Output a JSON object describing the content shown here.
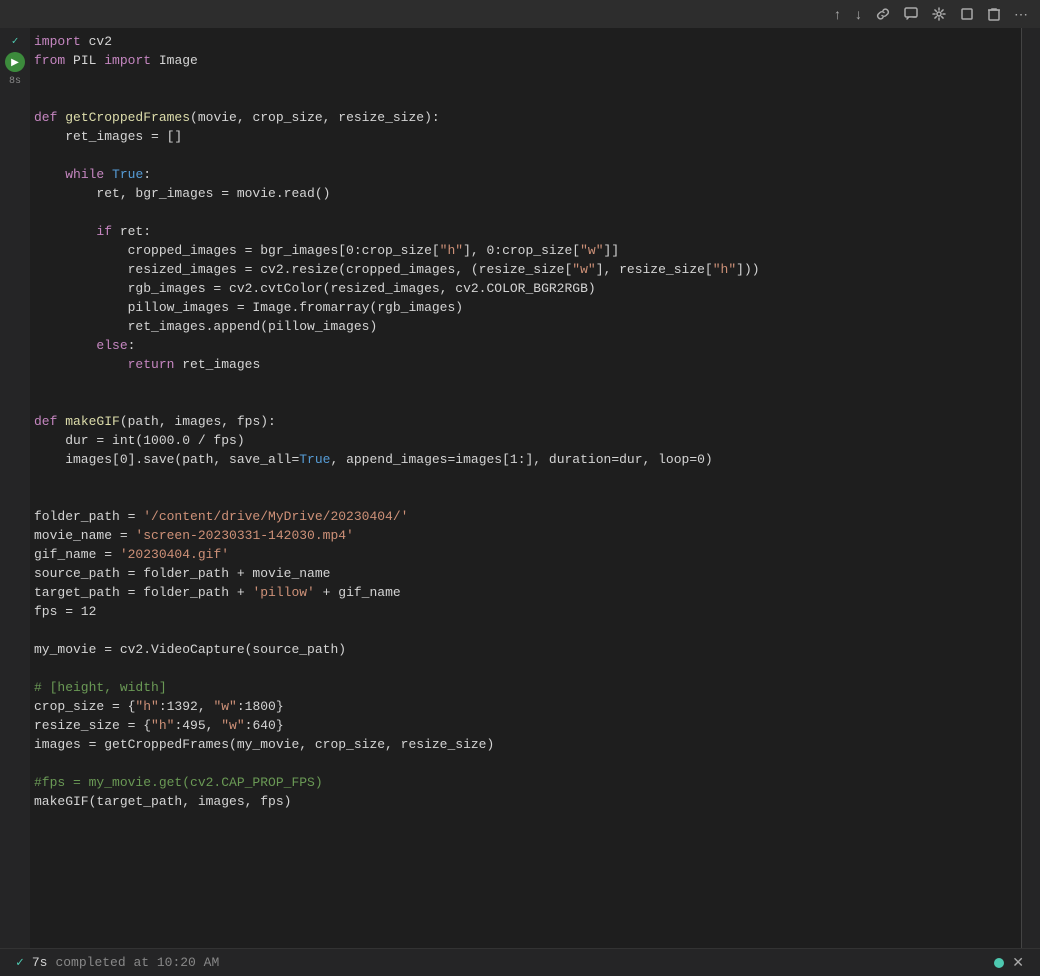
{
  "toolbar": {
    "buttons": [
      "↑",
      "↓",
      "🔗",
      "💬",
      "⚙",
      "⬜",
      "🗑",
      "⋯"
    ]
  },
  "code": {
    "lines": [
      {
        "tokens": [
          {
            "t": "kw",
            "v": "import"
          },
          {
            "t": "plain",
            "v": " cv2"
          }
        ]
      },
      {
        "tokens": [
          {
            "t": "kw",
            "v": "from"
          },
          {
            "t": "plain",
            "v": " PIL "
          },
          {
            "t": "kw",
            "v": "import"
          },
          {
            "t": "plain",
            "v": " Image"
          }
        ]
      },
      {
        "tokens": [
          {
            "t": "plain",
            "v": ""
          }
        ]
      },
      {
        "tokens": [
          {
            "t": "plain",
            "v": ""
          }
        ]
      },
      {
        "tokens": [
          {
            "t": "kw",
            "v": "def"
          },
          {
            "t": "plain",
            "v": " "
          },
          {
            "t": "fn",
            "v": "getCroppedFrames"
          },
          {
            "t": "plain",
            "v": "(movie, crop_size, resize_size):"
          }
        ]
      },
      {
        "tokens": [
          {
            "t": "plain",
            "v": "    ret_images = []"
          }
        ]
      },
      {
        "tokens": [
          {
            "t": "plain",
            "v": ""
          }
        ]
      },
      {
        "tokens": [
          {
            "t": "plain",
            "v": "    "
          },
          {
            "t": "kw",
            "v": "while"
          },
          {
            "t": "plain",
            "v": " "
          },
          {
            "t": "kw-blue",
            "v": "True"
          },
          {
            "t": "plain",
            "v": ":"
          }
        ]
      },
      {
        "tokens": [
          {
            "t": "plain",
            "v": "        ret, bgr_images = movie.read()"
          }
        ]
      },
      {
        "tokens": [
          {
            "t": "plain",
            "v": ""
          }
        ]
      },
      {
        "tokens": [
          {
            "t": "plain",
            "v": "        "
          },
          {
            "t": "kw",
            "v": "if"
          },
          {
            "t": "plain",
            "v": " ret:"
          }
        ]
      },
      {
        "tokens": [
          {
            "t": "plain",
            "v": "            cropped_images = bgr_images[0:crop_size["
          },
          {
            "t": "str",
            "v": "\"h\""
          },
          {
            "t": "plain",
            "v": "], 0:crop_size["
          },
          {
            "t": "str",
            "v": "\"w\""
          },
          {
            "t": "plain",
            "v": "]]"
          }
        ]
      },
      {
        "tokens": [
          {
            "t": "plain",
            "v": "            resized_images = cv2.resize(cropped_images, (resize_size["
          },
          {
            "t": "str",
            "v": "\"w\""
          },
          {
            "t": "plain",
            "v": "], resize_size["
          },
          {
            "t": "str",
            "v": "\"h\""
          },
          {
            "t": "plain",
            "v": "]))"
          }
        ]
      },
      {
        "tokens": [
          {
            "t": "plain",
            "v": "            rgb_images = cv2.cvtColor(resized_images, cv2.COLOR_BGR2RGB)"
          }
        ]
      },
      {
        "tokens": [
          {
            "t": "plain",
            "v": "            pillow_images = Image.fromarray(rgb_images)"
          }
        ]
      },
      {
        "tokens": [
          {
            "t": "plain",
            "v": "            ret_images.append(pillow_images)"
          }
        ]
      },
      {
        "tokens": [
          {
            "t": "plain",
            "v": "        "
          },
          {
            "t": "kw",
            "v": "else"
          },
          {
            "t": "plain",
            "v": ":"
          }
        ]
      },
      {
        "tokens": [
          {
            "t": "plain",
            "v": "            "
          },
          {
            "t": "kw",
            "v": "return"
          },
          {
            "t": "plain",
            "v": " ret_images"
          }
        ]
      },
      {
        "tokens": [
          {
            "t": "plain",
            "v": ""
          }
        ]
      },
      {
        "tokens": [
          {
            "t": "plain",
            "v": ""
          }
        ]
      },
      {
        "tokens": [
          {
            "t": "kw",
            "v": "def"
          },
          {
            "t": "plain",
            "v": " "
          },
          {
            "t": "fn",
            "v": "makeGIF"
          },
          {
            "t": "plain",
            "v": "(path, images, fps):"
          }
        ]
      },
      {
        "tokens": [
          {
            "t": "plain",
            "v": "    dur = int(1000.0 / fps)"
          }
        ]
      },
      {
        "tokens": [
          {
            "t": "plain",
            "v": "    images[0].save(path, save_all="
          },
          {
            "t": "kw-blue",
            "v": "True"
          },
          {
            "t": "plain",
            "v": ", append_images=images[1:], duration=dur, loop=0)"
          }
        ]
      },
      {
        "tokens": [
          {
            "t": "plain",
            "v": ""
          }
        ]
      },
      {
        "tokens": [
          {
            "t": "plain",
            "v": ""
          }
        ]
      },
      {
        "tokens": [
          {
            "t": "plain",
            "v": "folder_path = "
          },
          {
            "t": "str",
            "v": "'/content/drive/MyDrive/20230404/'"
          }
        ]
      },
      {
        "tokens": [
          {
            "t": "plain",
            "v": "movie_name = "
          },
          {
            "t": "str",
            "v": "'screen-20230331-142030.mp4'"
          }
        ]
      },
      {
        "tokens": [
          {
            "t": "plain",
            "v": "gif_name = "
          },
          {
            "t": "str",
            "v": "'20230404.gif'"
          }
        ]
      },
      {
        "tokens": [
          {
            "t": "plain",
            "v": "source_path = folder_path + movie_name"
          }
        ]
      },
      {
        "tokens": [
          {
            "t": "plain",
            "v": "target_path = folder_path + "
          },
          {
            "t": "str",
            "v": "'pillow'"
          },
          {
            "t": "plain",
            "v": " + gif_name"
          }
        ]
      },
      {
        "tokens": [
          {
            "t": "plain",
            "v": "fps = 12"
          }
        ]
      },
      {
        "tokens": [
          {
            "t": "plain",
            "v": ""
          }
        ]
      },
      {
        "tokens": [
          {
            "t": "plain",
            "v": "my_movie = cv2.VideoCapture(source_path)"
          }
        ]
      },
      {
        "tokens": [
          {
            "t": "plain",
            "v": ""
          }
        ]
      },
      {
        "tokens": [
          {
            "t": "comment",
            "v": "# [height, width]"
          }
        ]
      },
      {
        "tokens": [
          {
            "t": "plain",
            "v": "crop_size = {"
          },
          {
            "t": "str",
            "v": "\"h\""
          },
          {
            "t": "plain",
            "v": ":1392, "
          },
          {
            "t": "str",
            "v": "\"w\""
          },
          {
            "t": "plain",
            "v": ":1800}"
          }
        ]
      },
      {
        "tokens": [
          {
            "t": "plain",
            "v": "resize_size = {"
          },
          {
            "t": "str",
            "v": "\"h\""
          },
          {
            "t": "plain",
            "v": ":495, "
          },
          {
            "t": "str",
            "v": "\"w\""
          },
          {
            "t": "plain",
            "v": ":640}"
          }
        ]
      },
      {
        "tokens": [
          {
            "t": "plain",
            "v": "images = getCroppedFrames(my_movie, crop_size, resize_size)"
          }
        ]
      },
      {
        "tokens": [
          {
            "t": "plain",
            "v": ""
          }
        ]
      },
      {
        "tokens": [
          {
            "t": "comment",
            "v": "#fps = my_movie.get(cv2.CAP_PROP_FPS)"
          }
        ]
      },
      {
        "tokens": [
          {
            "t": "plain",
            "v": "makeGIF(target_path, images, fps)"
          }
        ]
      }
    ]
  },
  "statusbar": {
    "check_icon": "✓",
    "time": "7s",
    "message": "completed at 10:20 AM",
    "close_label": "✕"
  }
}
